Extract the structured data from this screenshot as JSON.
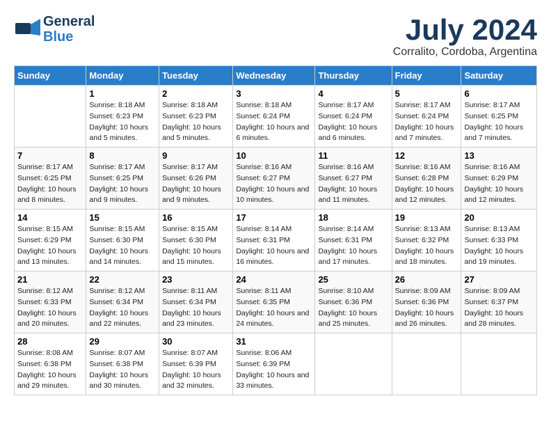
{
  "logo": {
    "line1": "General",
    "line2": "Blue"
  },
  "title": "July 2024",
  "subtitle": "Corralito, Cordoba, Argentina",
  "weekdays": [
    "Sunday",
    "Monday",
    "Tuesday",
    "Wednesday",
    "Thursday",
    "Friday",
    "Saturday"
  ],
  "weeks": [
    [
      null,
      {
        "day": 1,
        "sunrise": "8:18 AM",
        "sunset": "6:23 PM",
        "daylight": "10 hours and 5 minutes."
      },
      {
        "day": 2,
        "sunrise": "8:18 AM",
        "sunset": "6:23 PM",
        "daylight": "10 hours and 5 minutes."
      },
      {
        "day": 3,
        "sunrise": "8:18 AM",
        "sunset": "6:24 PM",
        "daylight": "10 hours and 6 minutes."
      },
      {
        "day": 4,
        "sunrise": "8:17 AM",
        "sunset": "6:24 PM",
        "daylight": "10 hours and 6 minutes."
      },
      {
        "day": 5,
        "sunrise": "8:17 AM",
        "sunset": "6:24 PM",
        "daylight": "10 hours and 7 minutes."
      },
      {
        "day": 6,
        "sunrise": "8:17 AM",
        "sunset": "6:25 PM",
        "daylight": "10 hours and 7 minutes."
      }
    ],
    [
      {
        "day": 7,
        "sunrise": "8:17 AM",
        "sunset": "6:25 PM",
        "daylight": "10 hours and 8 minutes."
      },
      {
        "day": 8,
        "sunrise": "8:17 AM",
        "sunset": "6:25 PM",
        "daylight": "10 hours and 9 minutes."
      },
      {
        "day": 9,
        "sunrise": "8:17 AM",
        "sunset": "6:26 PM",
        "daylight": "10 hours and 9 minutes."
      },
      {
        "day": 10,
        "sunrise": "8:16 AM",
        "sunset": "6:27 PM",
        "daylight": "10 hours and 10 minutes."
      },
      {
        "day": 11,
        "sunrise": "8:16 AM",
        "sunset": "6:27 PM",
        "daylight": "10 hours and 11 minutes."
      },
      {
        "day": 12,
        "sunrise": "8:16 AM",
        "sunset": "6:28 PM",
        "daylight": "10 hours and 12 minutes."
      },
      {
        "day": 13,
        "sunrise": "8:16 AM",
        "sunset": "6:29 PM",
        "daylight": "10 hours and 12 minutes."
      }
    ],
    [
      {
        "day": 14,
        "sunrise": "8:15 AM",
        "sunset": "6:29 PM",
        "daylight": "10 hours and 13 minutes."
      },
      {
        "day": 15,
        "sunrise": "8:15 AM",
        "sunset": "6:30 PM",
        "daylight": "10 hours and 14 minutes."
      },
      {
        "day": 16,
        "sunrise": "8:15 AM",
        "sunset": "6:30 PM",
        "daylight": "10 hours and 15 minutes."
      },
      {
        "day": 17,
        "sunrise": "8:14 AM",
        "sunset": "6:31 PM",
        "daylight": "10 hours and 16 minutes."
      },
      {
        "day": 18,
        "sunrise": "8:14 AM",
        "sunset": "6:31 PM",
        "daylight": "10 hours and 17 minutes."
      },
      {
        "day": 19,
        "sunrise": "8:13 AM",
        "sunset": "6:32 PM",
        "daylight": "10 hours and 18 minutes."
      },
      {
        "day": 20,
        "sunrise": "8:13 AM",
        "sunset": "6:33 PM",
        "daylight": "10 hours and 19 minutes."
      }
    ],
    [
      {
        "day": 21,
        "sunrise": "8:12 AM",
        "sunset": "6:33 PM",
        "daylight": "10 hours and 20 minutes."
      },
      {
        "day": 22,
        "sunrise": "8:12 AM",
        "sunset": "6:34 PM",
        "daylight": "10 hours and 22 minutes."
      },
      {
        "day": 23,
        "sunrise": "8:11 AM",
        "sunset": "6:34 PM",
        "daylight": "10 hours and 23 minutes."
      },
      {
        "day": 24,
        "sunrise": "8:11 AM",
        "sunset": "6:35 PM",
        "daylight": "10 hours and 24 minutes."
      },
      {
        "day": 25,
        "sunrise": "8:10 AM",
        "sunset": "6:36 PM",
        "daylight": "10 hours and 25 minutes."
      },
      {
        "day": 26,
        "sunrise": "8:09 AM",
        "sunset": "6:36 PM",
        "daylight": "10 hours and 26 minutes."
      },
      {
        "day": 27,
        "sunrise": "8:09 AM",
        "sunset": "6:37 PM",
        "daylight": "10 hours and 28 minutes."
      }
    ],
    [
      {
        "day": 28,
        "sunrise": "8:08 AM",
        "sunset": "6:38 PM",
        "daylight": "10 hours and 29 minutes."
      },
      {
        "day": 29,
        "sunrise": "8:07 AM",
        "sunset": "6:38 PM",
        "daylight": "10 hours and 30 minutes."
      },
      {
        "day": 30,
        "sunrise": "8:07 AM",
        "sunset": "6:39 PM",
        "daylight": "10 hours and 32 minutes."
      },
      {
        "day": 31,
        "sunrise": "8:06 AM",
        "sunset": "6:39 PM",
        "daylight": "10 hours and 33 minutes."
      },
      null,
      null,
      null
    ]
  ]
}
